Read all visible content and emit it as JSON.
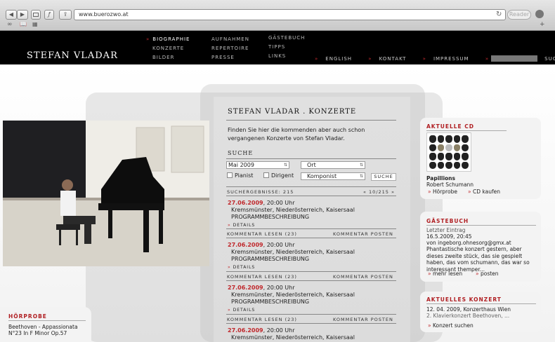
{
  "browser": {
    "address": "www.buerozwo.at",
    "reader_label": "Reader",
    "back_glyph": "◀",
    "forward_glyph": "▶",
    "reload_glyph": "↻"
  },
  "site": {
    "logo": "STEFAN VLADAR",
    "nav_col1": [
      "BIOGRAPHIE",
      "KONZERTE",
      "BILDER"
    ],
    "nav_col2": [
      "AUFNAHMEN",
      "REPERTOIRE",
      "PRESSE"
    ],
    "nav_col3": [
      "GÄSTEBUCH",
      "TIPPS",
      "LINKS"
    ],
    "topnav": [
      "ENGLISH",
      "KONTAKT",
      "IMPRESSUM"
    ],
    "search_label": "SUCHE"
  },
  "main": {
    "title": "STEFAN VLADAR . KONZERTE",
    "intro": "Finden Sie hier die kommenden aber auch schon vergangenen Konzerte von Stefan Vladar.",
    "search_heading": "SUCHE",
    "month_value": "Mai 2009",
    "ort_value": "Ort",
    "pianist_label": "Pianist",
    "dirigent_label": "Dirigent",
    "komponist_value": "Komponist",
    "search_button": "SUCHE",
    "results_label": "SUCHERGEBNISSE: 215",
    "pager": "« 10/215 »",
    "comments_read": "KOMMENTAR LESEN (23)",
    "comment_post": "KOMMENTAR POSTEN",
    "details_label": "DETAILS",
    "events": [
      {
        "date": "27.06.2009",
        "time": ", 20:00 Uhr",
        "place": "Kremsmünster",
        "place_rest": ", Niederösterreich, Kaisersaal",
        "desc": "PROGRAMMBESCHREIBUNG"
      },
      {
        "date": "27.06.2009",
        "time": ", 20:00 Uhr",
        "place": "Kremsmünster",
        "place_rest": ", Niederösterreich, Kaisersaal",
        "desc": "PROGRAMMBESCHREIBUNG"
      },
      {
        "date": "27.06.2009",
        "time": ", 20:00 Uhr",
        "place": "Kremsmünster",
        "place_rest": ", Niederösterreich, Kaisersaal",
        "desc": "PROGRAMMBESCHREIBUNG"
      },
      {
        "date": "27.06.2009",
        "time": ", 20:00 Uhr",
        "place": "Kremsmünster",
        "place_rest": ", Niederösterreich, Kaisersaal",
        "desc": ""
      }
    ]
  },
  "sidebar": {
    "cd_title": "AKTUELLE CD",
    "cd_name": "Papillions",
    "cd_composer": "Robert Schumann",
    "cd_links": [
      "Hörprobe",
      "CD kaufen"
    ],
    "guest_title": "GÄSTEBUCH",
    "guest_last": "Letzter Eintrag",
    "guest_date": "16.5.2009, 20:45",
    "guest_from": "von ingeborg.ohnesorg@gmx.at",
    "guest_text": "Phantastische konzert gestern, aber dieses zweite stück, das sie gespielt haben, das vom schumann, das war so interessant themper...",
    "guest_links": [
      "mehr lesen",
      "posten"
    ],
    "concert_title": "AKTUELLES KONZERT",
    "concert_line1": "12. 04. 2009, Konzerthaus Wien",
    "concert_line2": "2. Klavierkonzert Beethoven, ...",
    "concert_link": "Konzert suchen"
  },
  "hoerprobe": {
    "title": "HÖRPROBE",
    "line1": "Beethoven - Appassionata",
    "line2": "N°23 In F Minor Op.57"
  }
}
